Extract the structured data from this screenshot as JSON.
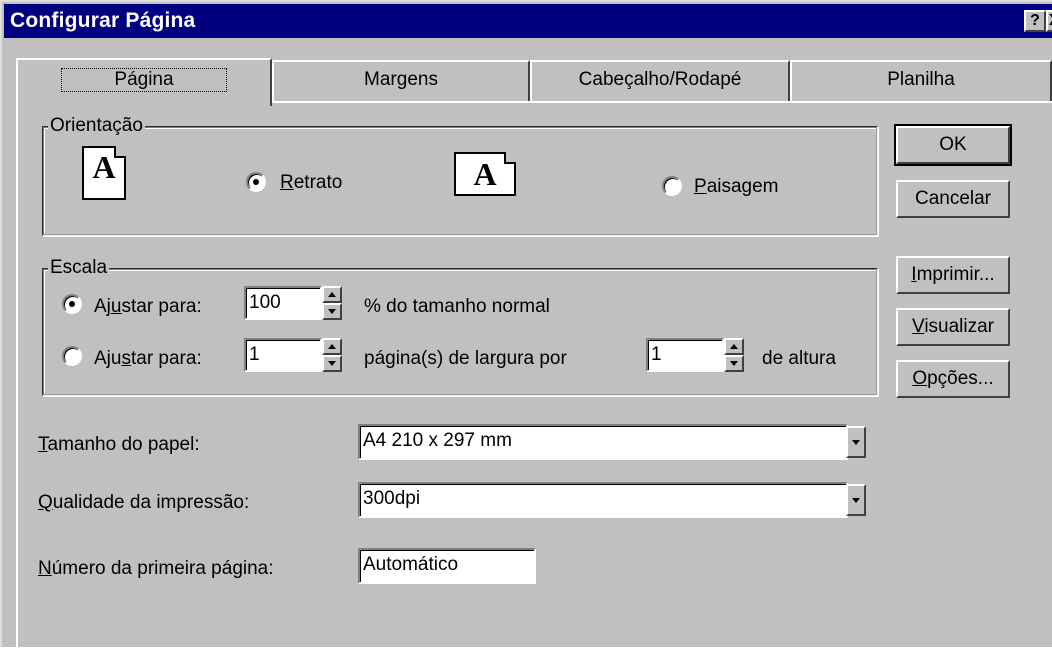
{
  "window": {
    "title": "Configurar Página",
    "help_glyph": "?",
    "close_glyph": "X"
  },
  "tabs": [
    {
      "label": "Página",
      "active": true
    },
    {
      "label": "Margens",
      "active": false
    },
    {
      "label": "Cabeçalho/Rodapé",
      "active": false
    },
    {
      "label": "Planilha",
      "active": false
    }
  ],
  "orientation": {
    "legend": "Orientação",
    "icon_glyph": "A",
    "portrait": {
      "label_first": "R",
      "label_rest": "etrato",
      "checked": true
    },
    "landscape": {
      "label_first": "P",
      "label_rest": "aisagem",
      "checked": false
    }
  },
  "scale": {
    "legend": "Escala",
    "adjust_percent": {
      "label_pre": "Aj",
      "label_u": "u",
      "label_post": "star para:",
      "value": "100",
      "suffix": "% do tamanho normal",
      "checked": true
    },
    "fit_to": {
      "label_pre": "Aju",
      "label_u": "s",
      "label_post": "tar para:",
      "width_value": "1",
      "width_suffix": "página(s) de largura por",
      "height_value": "1",
      "height_suffix": "de altura",
      "checked": false
    }
  },
  "paper_size": {
    "label_first": "T",
    "label_rest": "amanho do papel:",
    "value": "A4 210 x 297 mm"
  },
  "print_quality": {
    "label_first": "Q",
    "label_rest": "ualidade da impressão:",
    "value": "300dpi"
  },
  "first_page": {
    "label_first": "N",
    "label_rest": "úmero da primeira página:",
    "value": "Automático"
  },
  "buttons": {
    "ok": "OK",
    "cancel": "Cancelar",
    "print": {
      "first": "I",
      "rest": "mprimir..."
    },
    "preview": {
      "first": "V",
      "rest": "isualizar"
    },
    "options": {
      "first": "O",
      "rest": "pções..."
    }
  }
}
